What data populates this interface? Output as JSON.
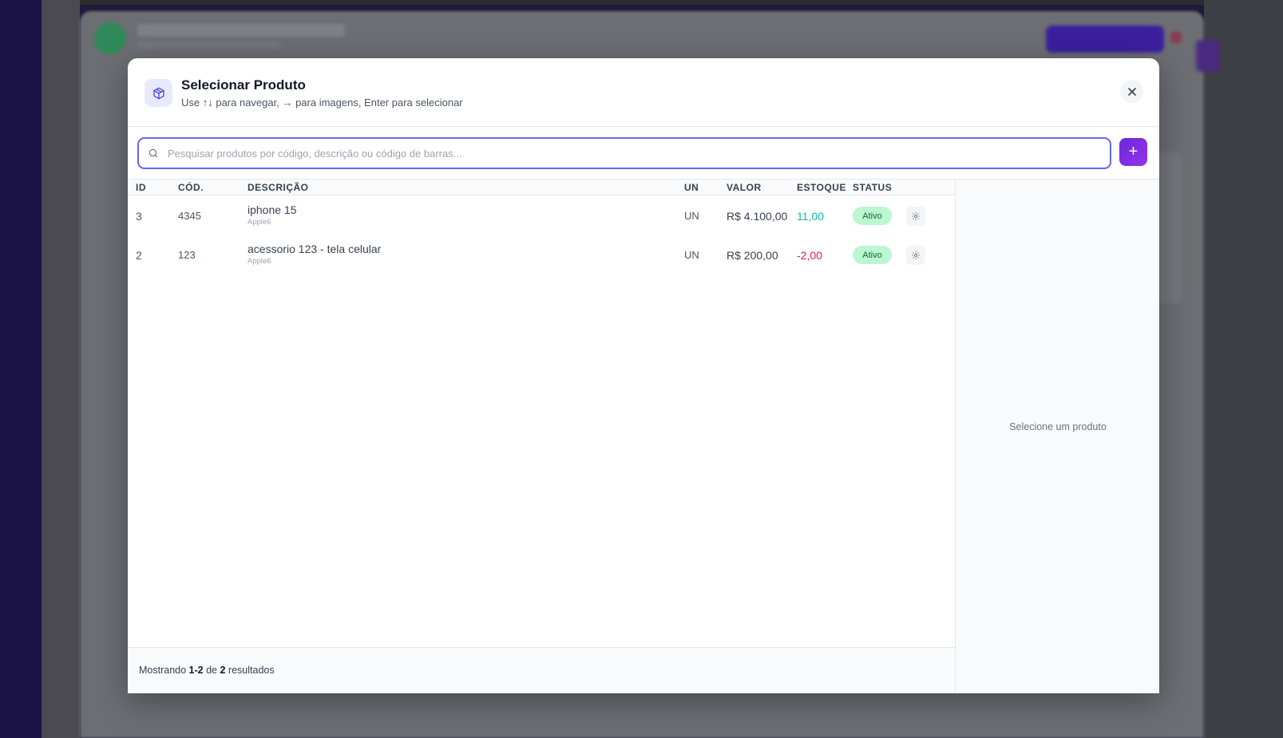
{
  "modal": {
    "title": "Selecionar Produto",
    "subtitle": "Use ↑↓ para navegar, → para imagens, Enter para selecionar",
    "icon": "package-icon",
    "close_icon": "close-icon"
  },
  "search": {
    "placeholder": "Pesquisar produtos por código, descrição ou código de barras...",
    "value": "",
    "add_icon": "plus-icon"
  },
  "table": {
    "headers": {
      "id": "ID",
      "code": "CÓD.",
      "description": "DESCRIÇÃO",
      "unit": "UN",
      "value": "VALOR",
      "stock": "ESTOQUE",
      "status": "STATUS"
    },
    "rows": [
      {
        "id": "3",
        "code": "4345",
        "description": "iphone 15",
        "brand": "Apple6",
        "unit": "UN",
        "value": "R$ 4.100,00",
        "stock": "11,00",
        "stock_color": "#14b8a6",
        "status": "Ativo"
      },
      {
        "id": "2",
        "code": "123",
        "description": "acessorio 123 - tela celular",
        "brand": "Apple6",
        "unit": "UN",
        "value": "R$ 200,00",
        "stock": "-2,00",
        "stock_color": "#e11d48",
        "status": "Ativo"
      }
    ]
  },
  "side_panel": {
    "empty_text": "Selecione um produto"
  },
  "footer": {
    "prefix": "Mostrando",
    "range": "1-2",
    "middle": "de",
    "total": "2",
    "suffix": "resultados"
  },
  "colors": {
    "accent": "#6366f1",
    "add_button": "#7c3aed",
    "status_active_bg": "#bbf7d0"
  }
}
